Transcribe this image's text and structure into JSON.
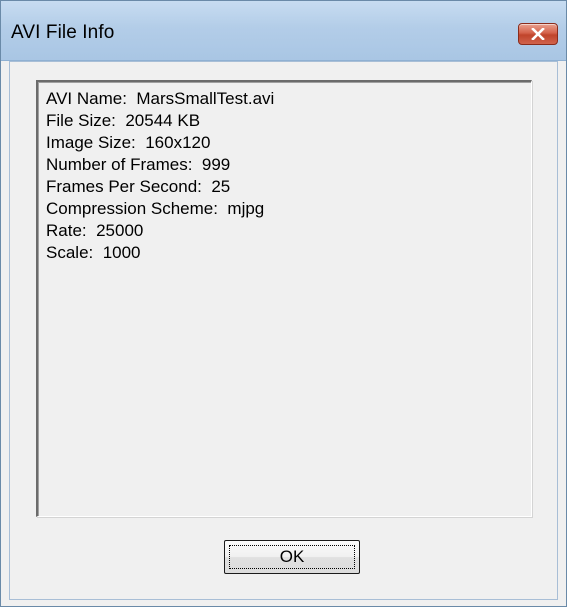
{
  "window": {
    "title": "AVI File Info"
  },
  "info": {
    "lines": [
      "AVI Name:  MarsSmallTest.avi",
      "File Size:  20544 KB",
      "Image Size:  160x120",
      "Number of Frames:  999",
      "Frames Per Second:  25",
      "Compression Scheme:  mjpg",
      "Rate:  25000",
      "Scale:  1000"
    ]
  },
  "buttons": {
    "ok_label": "OK"
  },
  "icons": {
    "close": "close-icon"
  },
  "colors": {
    "titlebar": "#b3cde8",
    "close_button": "#c0442b",
    "dialog_background": "#f0f0f0"
  }
}
